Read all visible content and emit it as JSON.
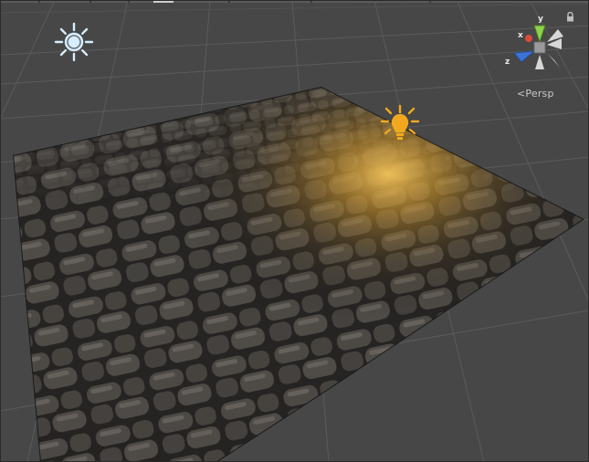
{
  "window": {
    "title": ""
  },
  "gizmo": {
    "axis_y": "y",
    "axis_x": "x",
    "axis_z": "z",
    "colors": {
      "y": "#8fd14a",
      "x": "#d94a3a",
      "z": "#3b73d6",
      "neutral": "#d7d7d7"
    }
  },
  "view": {
    "projection_label": "Persp",
    "projection_glyph": "<"
  },
  "icons": {
    "directional_light": "sun-icon",
    "point_light": "light-bulb-icon",
    "lock": "lock-icon"
  },
  "colors": {
    "viewport_bg": "#474747",
    "grid_line": "#5b5b5b",
    "sun_icon": "#d7eeff",
    "bulb_icon": "#f2a81e"
  }
}
